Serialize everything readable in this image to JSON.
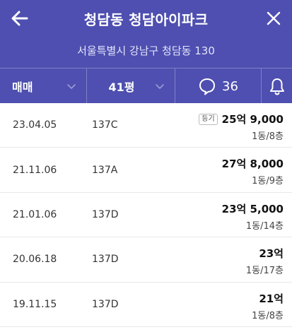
{
  "header": {
    "title": "청담동 청담아이파크",
    "address": "서울특별시 강남구 청담동 130"
  },
  "filters": {
    "trade_type": "매매",
    "size": "41평",
    "comment_count": "36"
  },
  "transactions": [
    {
      "date": "23.04.05",
      "type": "137C",
      "badge": "등기",
      "price": "25억 9,000",
      "floor": "1동/8층"
    },
    {
      "date": "21.11.06",
      "type": "137A",
      "badge": "",
      "price": "27억 8,000",
      "floor": "1동/9층"
    },
    {
      "date": "21.01.06",
      "type": "137D",
      "badge": "",
      "price": "23억 5,000",
      "floor": "1동/14층"
    },
    {
      "date": "20.06.18",
      "type": "137D",
      "badge": "",
      "price": "23억",
      "floor": "1동/17층"
    },
    {
      "date": "19.11.15",
      "type": "137D",
      "badge": "",
      "price": "21억",
      "floor": "1동/8층"
    }
  ],
  "colors": {
    "header_bg": "#4e4fb0",
    "text": "#222222"
  }
}
